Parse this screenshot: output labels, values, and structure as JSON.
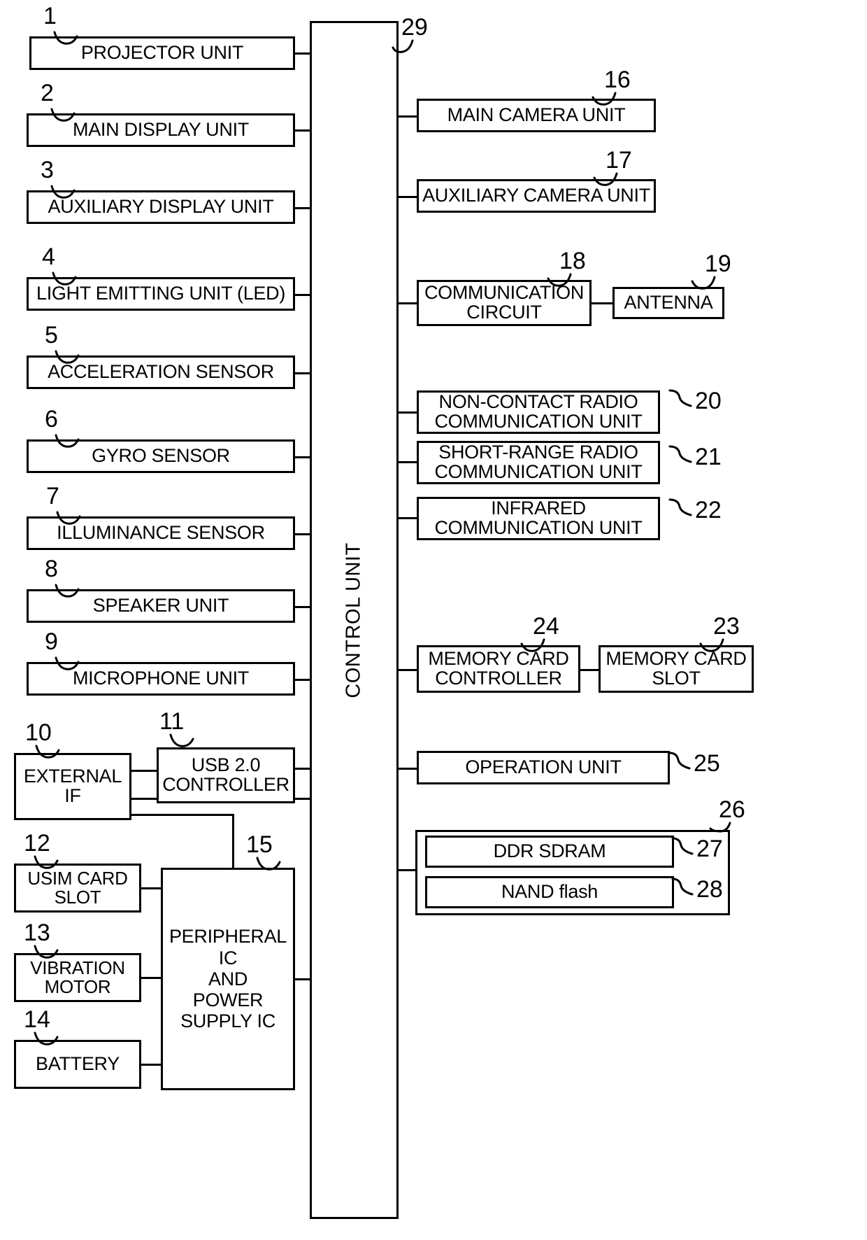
{
  "figure": {
    "type": "patent-block-diagram",
    "control_unit": {
      "label": "CONTROL UNIT",
      "ref": "29"
    }
  },
  "left_blocks": [
    {
      "ref": "1",
      "label": "PROJECTOR UNIT"
    },
    {
      "ref": "2",
      "label": "MAIN DISPLAY UNIT"
    },
    {
      "ref": "3",
      "label": "AUXILIARY DISPLAY UNIT"
    },
    {
      "ref": "4",
      "label": "LIGHT EMITTING UNIT (LED)"
    },
    {
      "ref": "5",
      "label": "ACCELERATION SENSOR"
    },
    {
      "ref": "6",
      "label": "GYRO SENSOR"
    },
    {
      "ref": "7",
      "label": "ILLUMINANCE SENSOR"
    },
    {
      "ref": "8",
      "label": "SPEAKER UNIT"
    },
    {
      "ref": "9",
      "label": "MICROPHONE UNIT"
    },
    {
      "ref": "10",
      "label": "EXTERNAL\nIF"
    },
    {
      "ref": "11",
      "label": "USB 2.0\nCONTROLLER"
    },
    {
      "ref": "12",
      "label": "USIM CARD\nSLOT"
    },
    {
      "ref": "13",
      "label": "VIBRATION\nMOTOR"
    },
    {
      "ref": "14",
      "label": "BATTERY"
    },
    {
      "ref": "15",
      "label": "PERIPHERAL\nIC\nAND\nPOWER\nSUPPLY IC"
    }
  ],
  "right_blocks": [
    {
      "ref": "16",
      "label": "MAIN CAMERA UNIT"
    },
    {
      "ref": "17",
      "label": "AUXILIARY CAMERA UNIT"
    },
    {
      "ref": "18",
      "label": "COMMUNICATION\nCIRCUIT"
    },
    {
      "ref": "19",
      "label": "ANTENNA"
    },
    {
      "ref": "20",
      "label": "NON-CONTACT RADIO\nCOMMUNICATION UNIT"
    },
    {
      "ref": "21",
      "label": "SHORT-RANGE RADIO\nCOMMUNICATION UNIT"
    },
    {
      "ref": "22",
      "label": "INFRARED\nCOMMUNICATION UNIT"
    },
    {
      "ref": "23",
      "label": "MEMORY CARD\nSLOT"
    },
    {
      "ref": "24",
      "label": "MEMORY CARD\nCONTROLLER"
    },
    {
      "ref": "25",
      "label": "OPERATION UNIT"
    },
    {
      "ref": "26",
      "label": ""
    },
    {
      "ref": "27",
      "label": "DDR SDRAM"
    },
    {
      "ref": "28",
      "label": "NAND flash"
    }
  ],
  "refs": {
    "n1": "1",
    "n2": "2",
    "n3": "3",
    "n4": "4",
    "n5": "5",
    "n6": "6",
    "n7": "7",
    "n8": "8",
    "n9": "9",
    "n10": "10",
    "n11": "11",
    "n12": "12",
    "n13": "13",
    "n14": "14",
    "n15": "15",
    "n16": "16",
    "n17": "17",
    "n18": "18",
    "n19": "19",
    "n20": "20",
    "n21": "21",
    "n22": "22",
    "n23": "23",
    "n24": "24",
    "n25": "25",
    "n26": "26",
    "n27": "27",
    "n28": "28",
    "n29": "29"
  },
  "colors": {
    "line": "#000000",
    "background": "#ffffff"
  }
}
